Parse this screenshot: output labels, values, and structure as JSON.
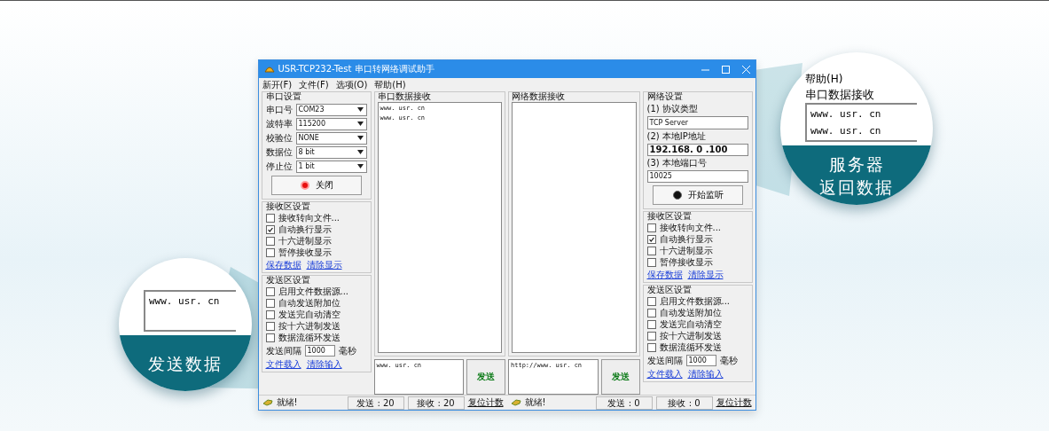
{
  "window": {
    "title": "USR-TCP232-Test 串口转网络调试助手"
  },
  "menu": [
    "新开(F)",
    "文件(F)",
    "选项(O)",
    "帮助(H)"
  ],
  "serial_settings": {
    "title": "串口设置",
    "fields": [
      {
        "label": "串口号",
        "value": "COM23"
      },
      {
        "label": "波特率",
        "value": "115200"
      },
      {
        "label": "校验位",
        "value": "NONE"
      },
      {
        "label": "数据位",
        "value": "8 bit"
      },
      {
        "label": "停止位",
        "value": "1 bit"
      }
    ],
    "button": {
      "label": "关闭",
      "active": true
    }
  },
  "left_receive_settings": {
    "title": "接收区设置",
    "options": [
      {
        "label": "接收转向文件...",
        "checked": false
      },
      {
        "label": "自动换行显示",
        "checked": true
      },
      {
        "label": "十六进制显示",
        "checked": false
      },
      {
        "label": "暂停接收显示",
        "checked": false
      }
    ],
    "links": [
      "保存数据",
      "清除显示"
    ]
  },
  "left_send_settings": {
    "title": "发送区设置",
    "options": [
      {
        "label": "启用文件数据源...",
        "checked": false
      },
      {
        "label": "自动发送附加位",
        "checked": false
      },
      {
        "label": "发送完自动清空",
        "checked": false
      },
      {
        "label": "按十六进制发送",
        "checked": false
      },
      {
        "label": "数据流循环发送",
        "checked": false
      }
    ],
    "interval_label": "发送间隔",
    "interval_value": "1000",
    "interval_unit": "毫秒",
    "links": [
      "文件载入",
      "清除输入"
    ]
  },
  "serial_receive": {
    "title": "串口数据接收",
    "lines": [
      "www. usr. cn",
      "www. usr. cn"
    ]
  },
  "network_receive": {
    "title": "网络数据接收"
  },
  "serial_send": {
    "value": "www. usr. cn",
    "button": "发送"
  },
  "network_send": {
    "value": "http://www. usr. cn",
    "button": "发送"
  },
  "network_settings": {
    "title": "网络设置",
    "protocol_label": "(1) 协议类型",
    "protocol": "TCP Server",
    "ip_label": "(2) 本地IP地址",
    "ip": "192.168. 0 .100",
    "port_label": "(3) 本地端口号",
    "port": "10025",
    "button": {
      "label": "开始监听",
      "active": false
    }
  },
  "right_receive_settings": {
    "title": "接收区设置",
    "options": [
      {
        "label": "接收转向文件...",
        "checked": false
      },
      {
        "label": "自动换行显示",
        "checked": true
      },
      {
        "label": "十六进制显示",
        "checked": false
      },
      {
        "label": "暂停接收显示",
        "checked": false
      }
    ],
    "links": [
      "保存数据",
      "清除显示"
    ]
  },
  "right_send_settings": {
    "title": "发送区设置",
    "options": [
      {
        "label": "启用文件数据源...",
        "checked": false
      },
      {
        "label": "自动发送附加位",
        "checked": false
      },
      {
        "label": "发送完自动清空",
        "checked": false
      },
      {
        "label": "按十六进制发送",
        "checked": false
      },
      {
        "label": "数据流循环发送",
        "checked": false
      }
    ],
    "interval_label": "发送间隔",
    "interval_value": "1000",
    "interval_unit": "毫秒",
    "links": [
      "文件载入",
      "清除输入"
    ]
  },
  "status_left": {
    "status": "就绪!",
    "sent": "发送 : 20",
    "received": "接收 : 20",
    "reset": "复位计数"
  },
  "status_right": {
    "status": "就绪!",
    "sent": "发送 : 0",
    "received": "接收 : 0",
    "reset": "复位计数"
  },
  "callouts": [
    {
      "lines": [
        "www. usr. cn"
      ],
      "caption": [
        "发送数据"
      ]
    },
    {
      "menu": "帮助(H)",
      "title": "串口数据接收",
      "lines": [
        "www. usr. cn",
        "www. usr. cn"
      ],
      "caption": [
        "服务器",
        "返回数据"
      ]
    }
  ]
}
